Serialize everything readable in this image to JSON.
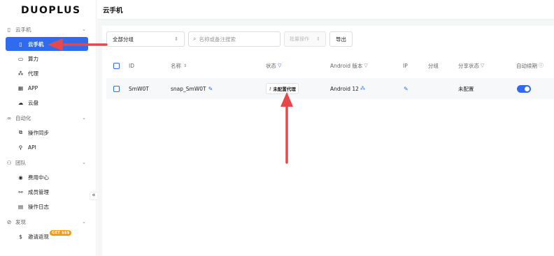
{
  "app": {
    "logo": "DUOPLUS"
  },
  "sidebar": {
    "groups": [
      {
        "label": "云手机",
        "icon": "phone-icon",
        "items": [
          {
            "label": "云手机",
            "icon": "phone-icon",
            "active": true
          },
          {
            "label": "算力",
            "icon": "monitor-icon"
          },
          {
            "label": "代理",
            "icon": "network-icon"
          },
          {
            "label": "APP",
            "icon": "grid-icon"
          },
          {
            "label": "云盘",
            "icon": "cloud-icon"
          }
        ]
      },
      {
        "label": "自动化",
        "icon": "infinity-icon",
        "items": [
          {
            "label": "操作同步",
            "icon": "sync-icon"
          },
          {
            "label": "API",
            "icon": "link-icon"
          }
        ]
      },
      {
        "label": "团队",
        "icon": "team-icon",
        "items": [
          {
            "label": "费用中心",
            "icon": "dollar-icon"
          },
          {
            "label": "成员管理",
            "icon": "members-icon"
          },
          {
            "label": "操作日志",
            "icon": "log-icon"
          }
        ]
      },
      {
        "label": "发现",
        "icon": "compass-icon",
        "items": [
          {
            "label": "邀请返现",
            "icon": "dollar-sign-icon",
            "badge": "GET $$$"
          }
        ]
      }
    ],
    "collapse_glyph": "«"
  },
  "header": {
    "title": "云手机"
  },
  "toolbar": {
    "group_select": "全部分组",
    "search_placeholder": "名称或备注搜索",
    "batch_label": "批量操作",
    "export_label": "导出"
  },
  "table": {
    "columns": {
      "id": "ID",
      "name": "名称",
      "status": "状态",
      "android": "Android 版本",
      "ip": "IP",
      "group": "分组",
      "share": "分享状态",
      "renew": "自动续期"
    },
    "rows": [
      {
        "id": "SmW0T",
        "name": "snap_SmW0T",
        "status": "未配置代理",
        "android": "Android 12",
        "ip": "",
        "group": "",
        "share": "未配置",
        "renew_on": true
      }
    ]
  },
  "colors": {
    "accent": "#2f6bef",
    "arrow": "#e8474a",
    "badge": "#f39c12"
  }
}
